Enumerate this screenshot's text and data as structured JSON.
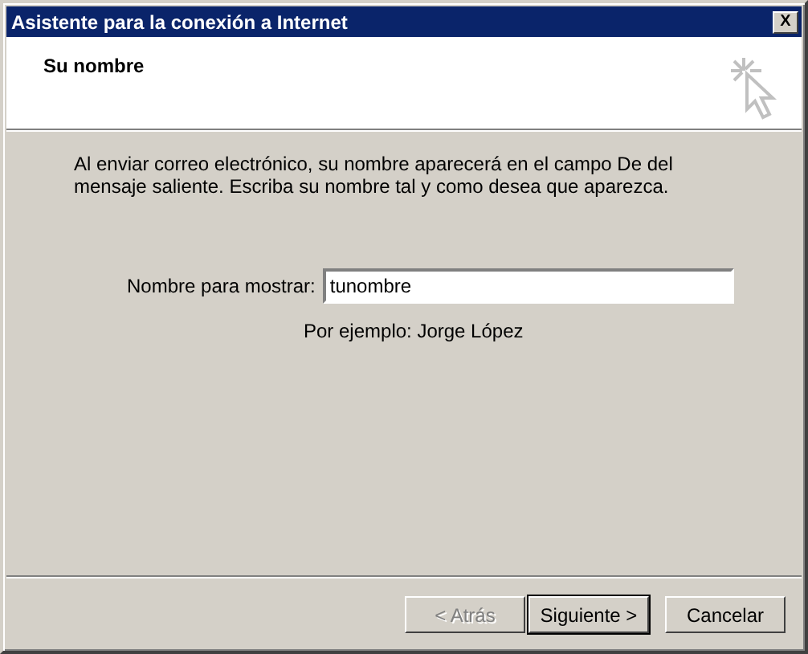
{
  "window": {
    "title": "Asistente para la conexión a Internet",
    "close": "X"
  },
  "header": {
    "title": "Su nombre"
  },
  "description": "Al enviar correo electrónico, su nombre aparecerá en el campo De del mensaje saliente. Escriba su nombre tal y como desea que aparezca.",
  "field": {
    "label": "Nombre para mostrar:",
    "value": "tunombre"
  },
  "example": "Por ejemplo: Jorge López",
  "buttons": [
    {
      "label": "< Atrás",
      "disabled": true,
      "default": false
    },
    {
      "label": "Siguiente >",
      "disabled": false,
      "default": true
    },
    {
      "label": "Cancelar",
      "disabled": false,
      "default": false
    }
  ]
}
